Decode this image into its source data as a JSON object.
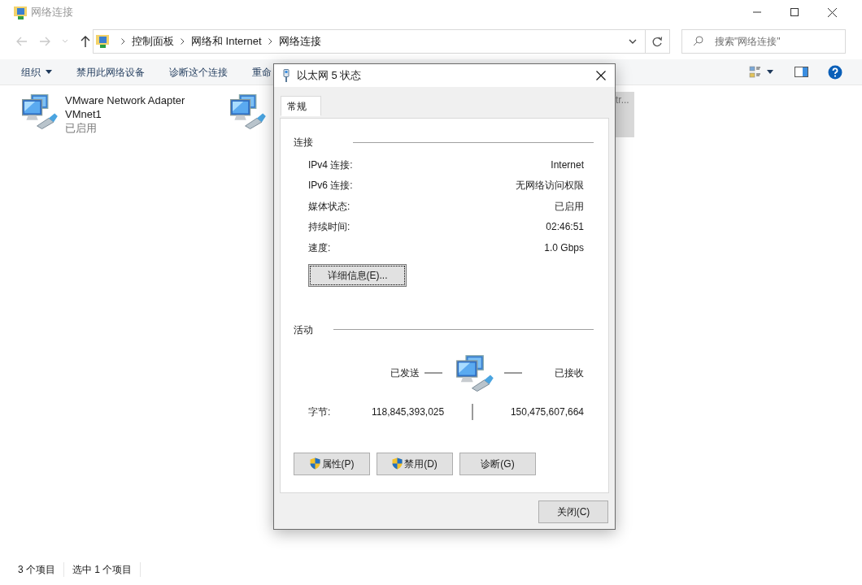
{
  "window": {
    "title": "网络连接"
  },
  "address": {
    "path": [
      "控制面板",
      "网络和 Internet",
      "网络连接"
    ]
  },
  "search": {
    "placeholder": "搜索\"网络连接\""
  },
  "toolbar": [
    {
      "label": "组织",
      "kind": "menu"
    },
    {
      "label": "禁用此网络设备",
      "kind": "command"
    },
    {
      "label": "诊断这个连接",
      "kind": "command"
    },
    {
      "label": "重命",
      "kind": "command"
    }
  ],
  "adapters": [
    {
      "name": "VMware Network Adapter",
      "device": "VMnet1",
      "status": "已启用",
      "selected": false
    },
    {
      "selected": false
    },
    {
      "device": "tr...",
      "selected": true
    }
  ],
  "status_bar": [
    "3 个项目",
    "选中 1 个项目"
  ],
  "dialog": {
    "title": "以太网 5 状态",
    "tabs": [
      {
        "label": "常规",
        "selected": true
      }
    ],
    "connection": {
      "heading": "连接",
      "rows": [
        {
          "label": "IPv4 连接:",
          "value": "Internet"
        },
        {
          "label": "IPv6 连接:",
          "value": "无网络访问权限"
        },
        {
          "label": "媒体状态:",
          "value": "已启用"
        },
        {
          "label": "持续时间:",
          "value": "02:46:51"
        },
        {
          "label": "速度:",
          "value": "1.0 Gbps"
        }
      ],
      "details_button": "详细信息(E)..."
    },
    "activity": {
      "heading": "活动",
      "sent_label": "已发送",
      "received_label": "已接收",
      "bytes_label": "字节:",
      "sent": "118,845,393,025",
      "received": "150,475,607,664"
    },
    "buttons": [
      {
        "label": "属性(P)",
        "shield": true
      },
      {
        "label": "禁用(D)",
        "shield": true
      },
      {
        "label": "诊断(G)",
        "shield": false
      }
    ],
    "close_button": "关闭(C)"
  }
}
